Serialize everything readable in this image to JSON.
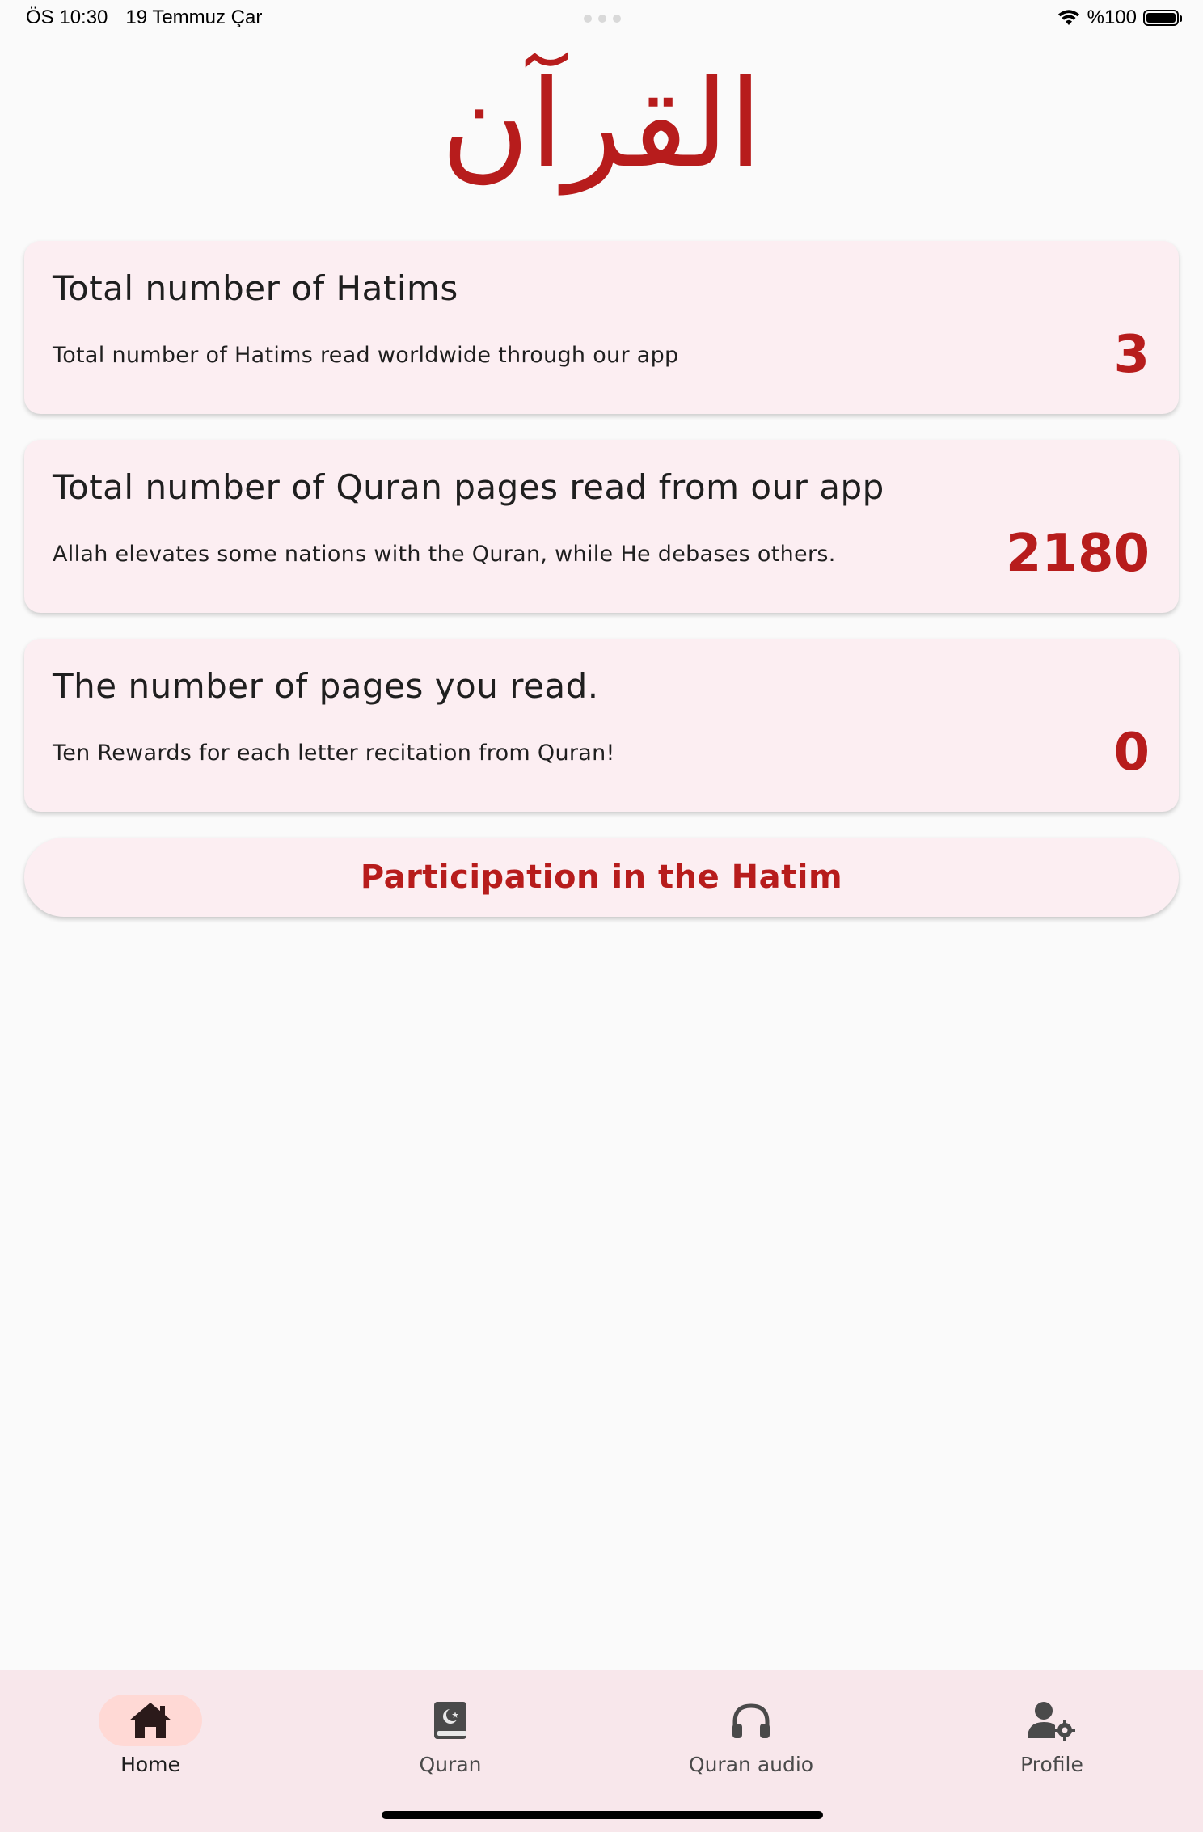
{
  "status_bar": {
    "time": "ÖS 10:30",
    "date": "19 Temmuz Çar",
    "battery": "%100"
  },
  "logo": {
    "text": "القرآن",
    "color": "#B71C1C"
  },
  "cards": [
    {
      "title": "Total number of Hatims",
      "subtitle": "Total number of Hatims read worldwide through our app",
      "value": "3"
    },
    {
      "title": "Total number of Quran pages read from our app",
      "subtitle": "Allah elevates some nations with the Quran, while He debases others.",
      "value": "2180"
    },
    {
      "title": "The number of pages you read.",
      "subtitle": "Ten Rewards for each letter recitation from Quran!",
      "value": "0"
    }
  ],
  "cta": {
    "label": "Participation in the Hatim"
  },
  "bottom_nav": {
    "items": [
      {
        "label": "Home",
        "icon": "home-icon",
        "active": true
      },
      {
        "label": "Quran",
        "icon": "quran-book-icon",
        "active": false
      },
      {
        "label": "Quran audio",
        "icon": "headphones-icon",
        "active": false
      },
      {
        "label": "Profile",
        "icon": "profile-settings-icon",
        "active": false
      }
    ]
  },
  "colors": {
    "accent": "#B71C1C",
    "card_bg": "#FCEEF2",
    "nav_bg": "#F8E7EB",
    "active_pill": "#FFD9D5",
    "page_bg": "#FAFAFA"
  }
}
